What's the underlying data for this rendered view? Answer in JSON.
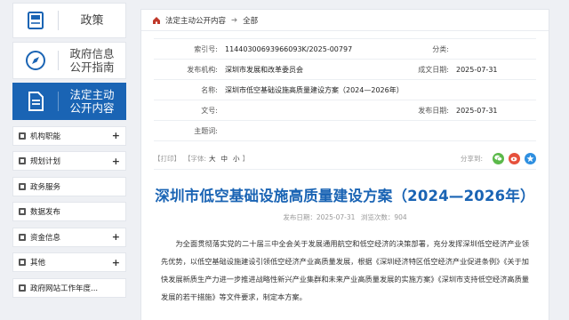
{
  "sidebar": {
    "big_items": [
      {
        "label": "政策",
        "icon": "policy-book-icon",
        "active": false
      },
      {
        "label": "政府信息\n公开指南",
        "icon": "compass-icon",
        "active": false
      },
      {
        "label": "法定主动\n公开内容",
        "icon": "document-icon",
        "active": true
      }
    ],
    "items": [
      {
        "label": "机构职能",
        "expand": "+"
      },
      {
        "label": "规划计划",
        "expand": "+"
      },
      {
        "label": "政务服务",
        "expand": ""
      },
      {
        "label": "数据发布",
        "expand": ""
      },
      {
        "label": "资金信息",
        "expand": "+"
      },
      {
        "label": "其他",
        "expand": "+"
      },
      {
        "label": "政府网站工作年度...",
        "expand": ""
      }
    ]
  },
  "breadcrumb": {
    "level1": "法定主动公开内容",
    "level2": "全部"
  },
  "meta": {
    "index_label": "索引号:",
    "index_value": "11440300693966093K/2025-00797",
    "category_label": "分类:",
    "category_value": "",
    "org_label": "发布机构:",
    "org_value": "深圳市发展和改革委员会",
    "created_label": "成文日期:",
    "created_value": "2025-07-31",
    "name_label": "名称:",
    "name_value": "深圳市低空基础设施高质量建设方案（2024—2026年）",
    "docno_label": "文号:",
    "docno_value": "",
    "published_label": "发布日期:",
    "published_value": "2025-07-31",
    "subject_label": "主题词:",
    "subject_value": ""
  },
  "tools": {
    "print": "【打印】",
    "font_open": "【字体:",
    "font_big": "大",
    "font_mid": "中",
    "font_small": "小",
    "font_close": "】",
    "share_label": "分享到:"
  },
  "article": {
    "title": "深圳市低空基础设施高质量建设方案（2024—2026年）",
    "publish_time": "发布日期：2025-07-31",
    "views": "浏览次数：904",
    "paragraph": "为全面贯彻落实党的二十届三中全会关于发展通用航空和低空经济的决策部署，充分发挥深圳低空经济产业领先优势，以低空基础设施建设引领低空经济产业高质量发展，根据《深圳经济特区低空经济产业促进条例》《关于加快发展新质生产力进一步推进战略性新兴产业集群和未来产业高质量发展的实施方案》《深圳市支持低空经济高质量发展的若干措施》等文件要求，制定本方案。"
  },
  "colors": {
    "accent": "#1a64b4",
    "wechat": "#5bb94a",
    "weibo": "#e6503c",
    "qzone": "#2e8fe0"
  }
}
